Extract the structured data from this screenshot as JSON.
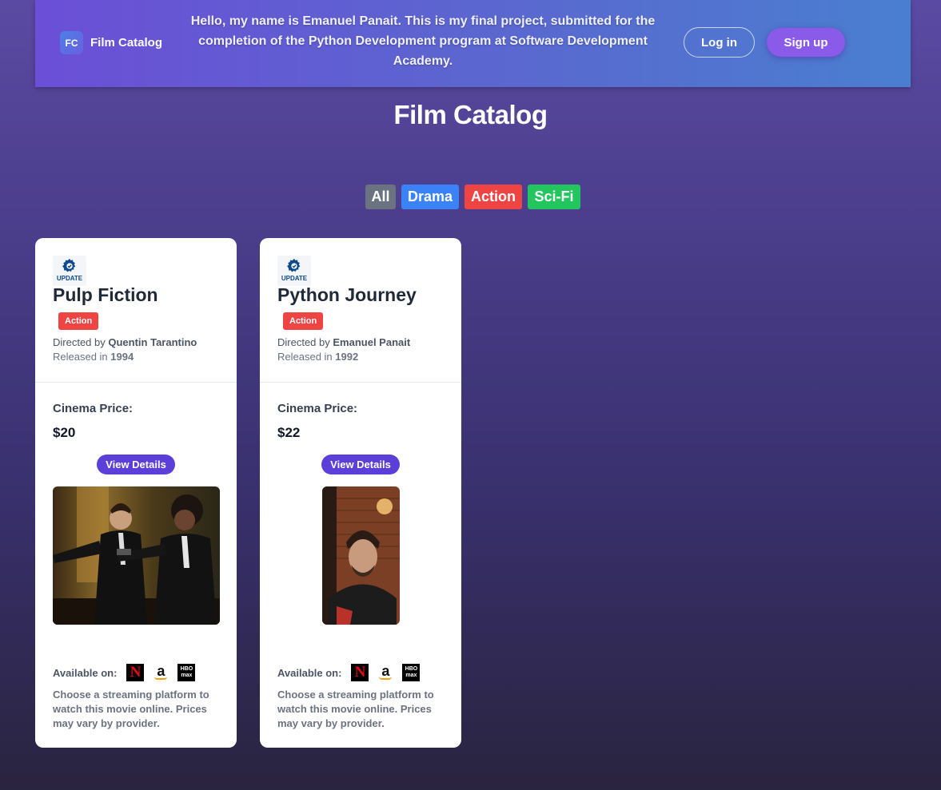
{
  "navbar": {
    "brand_logo": "FC",
    "brand_name": "Film Catalog",
    "intro": "Hello, my name is Emanuel Panait. This is my final project, submitted for the completion of the Python Development program at Software Development Academy.",
    "login_label": "Log in",
    "signup_label": "Sign up"
  },
  "page_title": "Film Catalog",
  "filters": [
    {
      "label": "All",
      "color": "#6b7280"
    },
    {
      "label": "Drama",
      "color": "#3b82f6"
    },
    {
      "label": "Action",
      "color": "#ef4444"
    },
    {
      "label": "Sci-Fi",
      "color": "#22c55e"
    }
  ],
  "cards": [
    {
      "update_label": "UPDATE",
      "title": "Pulp Fiction",
      "genre": "Action",
      "directed_prefix": "Directed by",
      "director": "Quentin Tarantino",
      "released_prefix": "Released in",
      "year": "1994",
      "price_label": "Cinema Price:",
      "price": "$20",
      "details_label": "View Details",
      "available_label": "Available on:",
      "platforms": [
        "netflix-icon",
        "amazon-icon",
        "hbo-max-icon"
      ],
      "stream_note": "Choose a streaming platform to watch this movie online. Prices may vary by provider."
    },
    {
      "update_label": "UPDATE",
      "title": "Python Journey",
      "genre": "Action",
      "directed_prefix": "Directed by",
      "director": "Emanuel Panait",
      "released_prefix": "Released in",
      "year": "1992",
      "price_label": "Cinema Price:",
      "price": "$22",
      "details_label": "View Details",
      "available_label": "Available on:",
      "platforms": [
        "netflix-icon",
        "amazon-icon",
        "hbo-max-icon"
      ],
      "stream_note": "Choose a streaming platform to watch this movie online. Prices may vary by provider."
    }
  ],
  "logos": {
    "netflix": "N",
    "amazon": "a",
    "hbo_top": "HBO",
    "hbo_bottom": "max"
  },
  "colors": {
    "accent": "#5b3fd9",
    "signup": "#8a5ae8",
    "genre_action": "#ef4444"
  }
}
